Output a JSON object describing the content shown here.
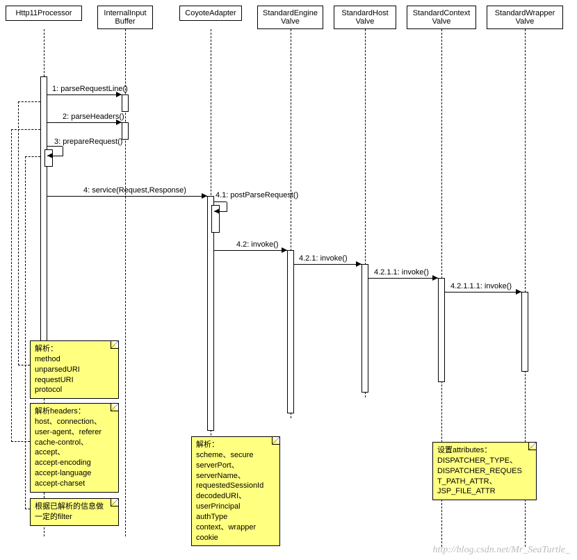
{
  "lifelines": {
    "http11": "Http11Processor",
    "inputbuf": "InternalInput\nBuffer",
    "coyote": "CoyoteAdapter",
    "engine": "StandardEngine\nValve",
    "host": "StandardHost\nValve",
    "context": "StandardContext\nValve",
    "wrapper": "StandardWrapper\nValve"
  },
  "messages": {
    "m1": "1: parseRequestLine()",
    "m2": "2: parseHeaders()",
    "m3": "3: prepareRequest()",
    "m4": "4: service(Request,Response)",
    "m41": "4.1: postParseRequest()",
    "m42": "4.2: invoke()",
    "m421": "4.2.1: invoke()",
    "m4211": "4.2.1.1: invoke()",
    "m42111": "4.2.1.1.1: invoke()"
  },
  "notes": {
    "note1_title": "解析：",
    "note1_l1": "method",
    "note1_l2": "unparsedURI",
    "note1_l3": "requestURI",
    "note1_l4": "protocol",
    "note2_title": "解析headers：",
    "note2_l1": "host、connection、",
    "note2_l2": "user-agent、referer",
    "note2_l3": "cache-control、",
    "note2_l4": "accept、",
    "note2_l5": "accept-encoding",
    "note2_l6": "accept-language",
    "note2_l7": "accept-charset",
    "note3_l1": "根据已解析的信息做",
    "note3_l2": "一定的filter",
    "note4_title": "解析：",
    "note4_l1": "scheme、secure",
    "note4_l2": "serverPort、",
    "note4_l3": "serverName、",
    "note4_l4": "requestedSessionId",
    "note4_l5": "decodedURI、",
    "note4_l6": "userPrincipal",
    "note4_l7": "authType",
    "note4_l8": "context、wrapper",
    "note4_l9": "cookie",
    "note5_title": "设置attributes：",
    "note5_l1": "DISPATCHER_TYPE、",
    "note5_l2": "DISPATCHER_REQUES",
    "note5_l3": "T_PATH_ATTR、",
    "note5_l4": "JSP_FILE_ATTR"
  },
  "watermark": "http://blog.csdn.net/Mr_SeaTurtle_"
}
